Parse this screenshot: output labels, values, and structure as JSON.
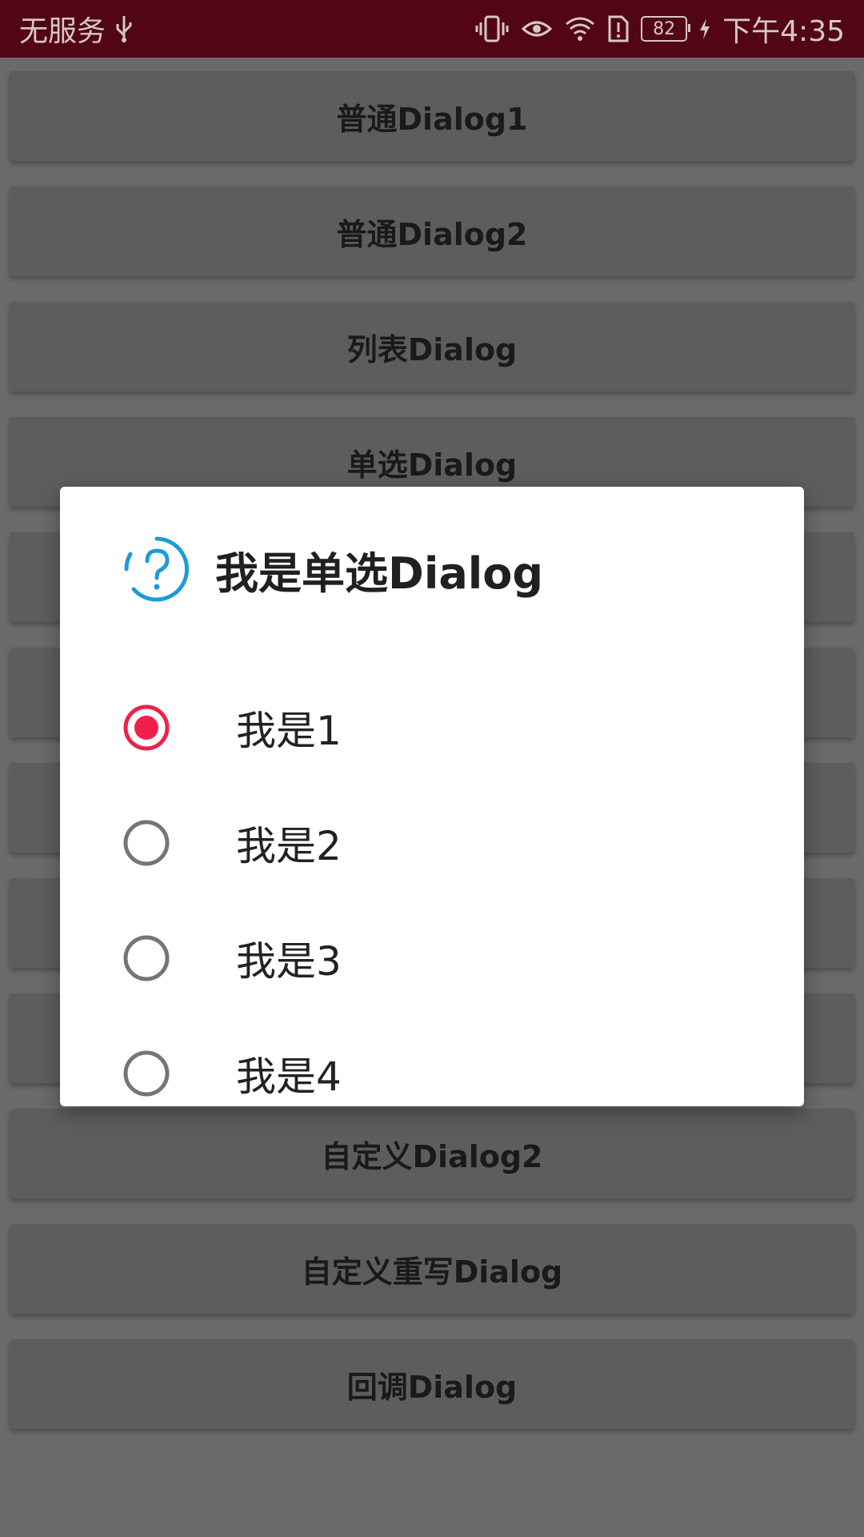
{
  "status_bar": {
    "carrier": "无服务",
    "battery": "82",
    "time": "下午4:35",
    "icons": [
      "usb-icon",
      "vibrate-icon",
      "eye-icon",
      "wifi-icon",
      "sim-alert-icon",
      "battery-icon",
      "charging-icon"
    ]
  },
  "background_buttons": [
    "普通Dialog1",
    "普通Dialog2",
    "列表Dialog",
    "单选Dialog",
    "",
    "",
    "",
    "",
    "",
    "自定义Dialog2",
    "自定义重写Dialog",
    "回调Dialog"
  ],
  "dialog": {
    "title": "我是单选Dialog",
    "icon": "help-circle-icon",
    "accent_color": "#1e9bd7",
    "radio_checked_color": "#f0204a",
    "options": [
      {
        "label": "我是1",
        "checked": true
      },
      {
        "label": "我是2",
        "checked": false
      },
      {
        "label": "我是3",
        "checked": false
      },
      {
        "label": "我是4",
        "checked": false
      }
    ]
  }
}
